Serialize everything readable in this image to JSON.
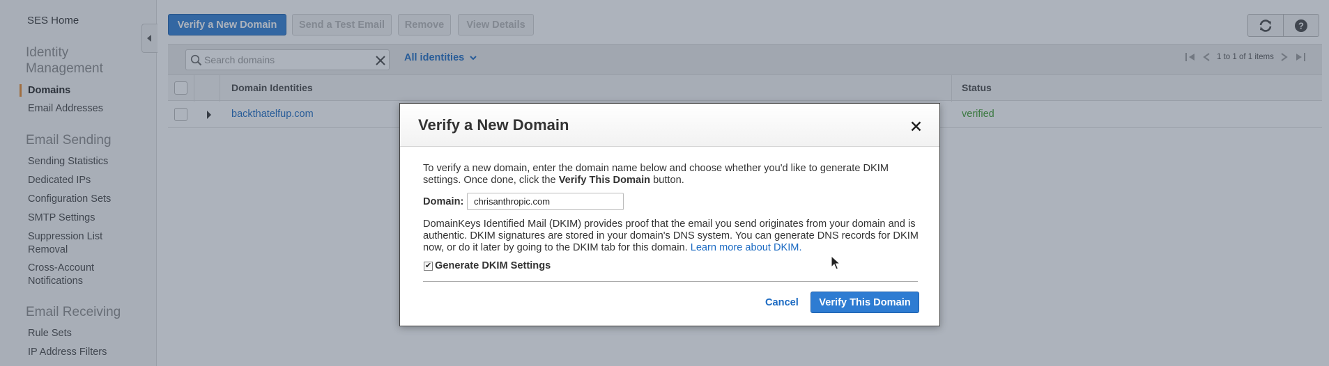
{
  "sidebar": {
    "home": "SES Home",
    "identity_heading": [
      "Identity",
      "Management"
    ],
    "identity_items": [
      "Domains",
      "Email Addresses"
    ],
    "sending_heading": "Email Sending",
    "sending_items": [
      "Sending Statistics",
      "Dedicated IPs",
      "Configuration Sets",
      "SMTP Settings",
      [
        "Suppression List",
        "Removal"
      ],
      [
        "Cross-Account",
        "Notifications"
      ]
    ],
    "receiving_heading": "Email Receiving",
    "receiving_items": [
      "Rule Sets",
      "IP Address Filters"
    ]
  },
  "toolbar": {
    "verify_new_domain": "Verify a New Domain",
    "send_test_email": "Send a Test Email",
    "remove": "Remove",
    "view_details": "View Details",
    "refresh_icon": "refresh-icon",
    "help_icon": "help-icon"
  },
  "filter": {
    "search_placeholder": "Search domains",
    "identity_filter": "All identities",
    "pager_text": "1 to 1 of 1 items"
  },
  "table": {
    "headers": [
      "Domain Identities",
      "Status"
    ],
    "rows": [
      {
        "domain": "backthatelfup.com",
        "status": "verified"
      }
    ]
  },
  "modal": {
    "title": "Verify a New Domain",
    "intro_before": "To verify a new domain, enter the domain name below and choose whether you'd like to generate DKIM settings. Once done, click the ",
    "intro_bold": "Verify This Domain",
    "intro_after": " button.",
    "domain_label": "Domain:",
    "domain_value": "chrisanthropic.com",
    "dkim_text": "DomainKeys Identified Mail (DKIM) provides proof that the email you send originates from your domain and is authentic. DKIM signatures are stored in your domain's DNS system. You can generate DNS records for DKIM now, or do it later by going to the DKIM tab for this domain. ",
    "dkim_link": "Learn more about DKIM.",
    "dkim_checkbox_label": "Generate DKIM Settings",
    "dkim_checked": true,
    "cancel": "Cancel",
    "verify": "Verify This Domain"
  },
  "colors": {
    "primary": "#2e7cd2",
    "link": "#1b6ac2",
    "verified": "#3b9a2a",
    "active_marker": "#e8882a"
  }
}
